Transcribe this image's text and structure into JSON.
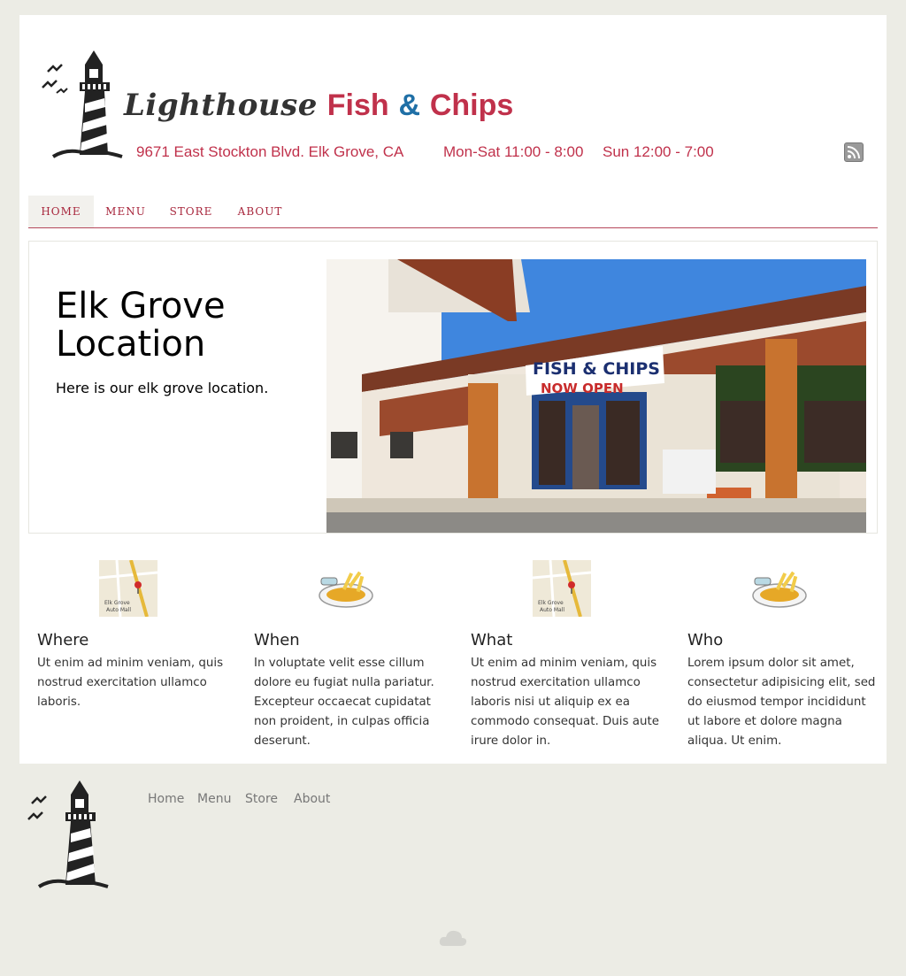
{
  "header": {
    "brand": {
      "part1": "Lighthouse",
      "part2": "Fish",
      "part3": "&",
      "part4": "Chips"
    },
    "address": "9671 East Stockton Blvd. Elk Grove, CA",
    "hours_weekday": "Mon-Sat  11:00 - 8:00",
    "hours_sunday": "Sun 12:00 - 7:00",
    "rss_icon": "rss-icon"
  },
  "nav": {
    "items": [
      {
        "label": "HOME",
        "active": true
      },
      {
        "label": "MENU"
      },
      {
        "label": "STORE"
      },
      {
        "label": "ABOUT"
      }
    ]
  },
  "hero": {
    "title": "Elk Grove Location",
    "text": "Here is our elk grove location.",
    "photo": {
      "banner_line1": "FISH & CHIPS",
      "banner_line2": "NOW OPEN"
    }
  },
  "features": [
    {
      "icon": "map-icon",
      "map_label1": "Elk Grove",
      "map_label2": "Auto Mall",
      "title": "Where",
      "text": "Ut enim ad minim veniam, quis nostrud exercitation ullamco laboris."
    },
    {
      "icon": "fish-chips-icon",
      "title": "When",
      "text": "In voluptate velit esse cillum dolore eu fugiat nulla pariatur. Excepteur occaecat cupidatat non proident, in culpas officia deserunt."
    },
    {
      "icon": "map-icon",
      "map_label1": "Elk Grove",
      "map_label2": "Auto Mall",
      "title": "What",
      "text": "Ut enim ad minim veniam, quis nostrud exercitation ullamco laboris nisi ut aliquip ex ea commodo consequat. Duis aute irure dolor in."
    },
    {
      "icon": "fish-chips-icon",
      "title": "Who",
      "text": "Lorem ipsum dolor sit amet, consectetur adipisicing elit, sed do eiusmod tempor incididunt ut labore et dolore magna aliqua. Ut enim."
    }
  ],
  "footer": {
    "nav": [
      "Home",
      "Menu",
      "Store",
      "About"
    ],
    "logo_icon": "lighthouse-icon",
    "cloud_icon": "cloud-icon"
  },
  "colors": {
    "brand_red": "#c0314b",
    "brand_blue": "#1f6fa6",
    "page_bg": "#ecece5"
  }
}
